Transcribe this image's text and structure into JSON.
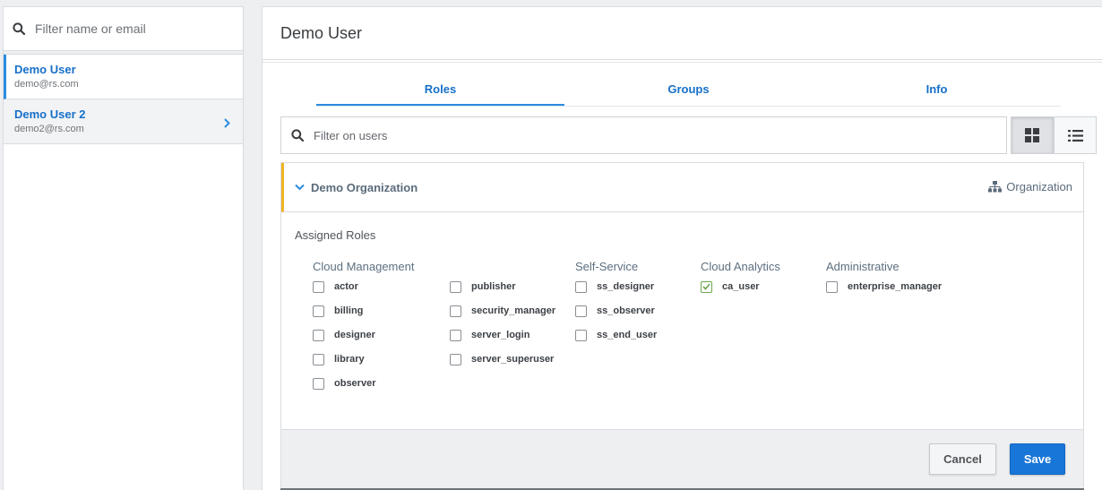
{
  "sidebar": {
    "search_placeholder": "Filter name or email",
    "users": [
      {
        "name": "Demo User",
        "email": "demo@rs.com",
        "selected": true
      },
      {
        "name": "Demo User 2",
        "email": "demo2@rs.com",
        "selected": false
      }
    ]
  },
  "main": {
    "title": "Demo User",
    "tabs": [
      {
        "label": "Roles",
        "active": true
      },
      {
        "label": "Groups",
        "active": false
      },
      {
        "label": "Info",
        "active": false
      }
    ],
    "filter_placeholder": "Filter on users",
    "view_mode": "grid"
  },
  "organization": {
    "name": "Demo Organization",
    "type_label": "Organization",
    "assigned_roles_label": "Assigned Roles",
    "groups": [
      {
        "title": "Cloud Management"
      },
      {
        "title": "Self-Service"
      },
      {
        "title": "Cloud Analytics"
      },
      {
        "title": "Administrative"
      }
    ],
    "roles": {
      "cloud_management": [
        {
          "label": "actor",
          "checked": false
        },
        {
          "label": "billing",
          "checked": false
        },
        {
          "label": "designer",
          "checked": false
        },
        {
          "label": "library",
          "checked": false
        },
        {
          "label": "observer",
          "checked": false
        },
        {
          "label": "publisher",
          "checked": false
        },
        {
          "label": "security_manager",
          "checked": false
        },
        {
          "label": "server_login",
          "checked": false
        },
        {
          "label": "server_superuser",
          "checked": false
        }
      ],
      "self_service": [
        {
          "label": "ss_designer",
          "checked": false
        },
        {
          "label": "ss_observer",
          "checked": false
        },
        {
          "label": "ss_end_user",
          "checked": false
        }
      ],
      "cloud_analytics": [
        {
          "label": "ca_user",
          "checked": true
        }
      ],
      "administrative": [
        {
          "label": "enterprise_manager",
          "checked": false
        }
      ]
    },
    "cancel_label": "Cancel",
    "save_label": "Save"
  },
  "colors": {
    "accent": "#1876d8",
    "link": "#1670c9",
    "org_marker": "#f0b323",
    "check": "#6aa84f"
  }
}
